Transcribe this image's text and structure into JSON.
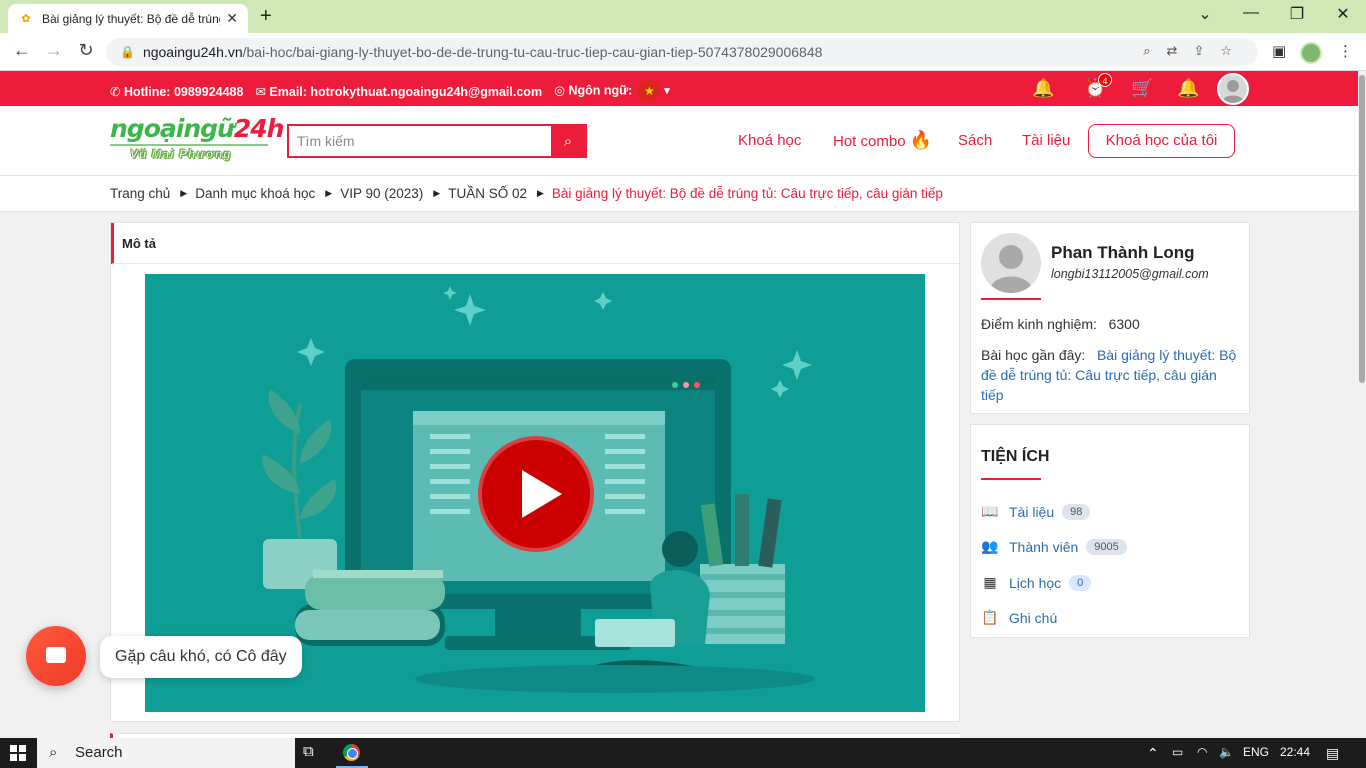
{
  "browser": {
    "tab_title": "Bài giảng lý thuyết: Bộ đề dễ trúng",
    "url_host": "ngoaingu24h.vn",
    "url_path": "/bai-hoc/bai-giang-ly-thuyet-bo-de-de-trung-tu-cau-truc-tiep-cau-gian-tiep-5074378029006848"
  },
  "topbar": {
    "hotline": "Hotline: 0989924488",
    "email": "Email: hotrokythuat.ngoaingu24h@gmail.com",
    "language_label": "Ngôn ngữ:",
    "alarm_badge": "4",
    "flag_color": "#da251d",
    "bar_color": "#ec1c3a"
  },
  "header": {
    "logo_text_green": "ngoại",
    "logo_text_green2": "ngữ",
    "logo_text_red": "24h",
    "logo_sub": "Vũ Mai Phương",
    "search_placeholder": "Tìm kiếm",
    "nav": {
      "courses": "Khoá học",
      "hot_combo": "Hot combo",
      "books": "Sách",
      "documents": "Tài liệu",
      "my_courses": "Khoá học của tôi"
    }
  },
  "breadcrumb": [
    "Trang chủ",
    "Danh mục khoá học",
    "VIP 90 (2023)",
    "TUẦN SỐ 02",
    "Bài giảng lý thuyết: Bộ đề dễ trúng tủ: Câu trực tiếp, câu gián tiếp"
  ],
  "main": {
    "section_title": "Mô tả"
  },
  "profile": {
    "name": "Phan Thành Long",
    "email": "longbi13112005@gmail.com",
    "exp_label": "Điểm kinh nghiệm:",
    "exp_value": "6300",
    "recent_label": "Bài học gần đây:",
    "recent_lesson": "Bài giảng lý thuyết: Bộ đề dễ trúng tủ: Câu trực tiếp, câu gián tiếp"
  },
  "tools": {
    "title": "TIỆN ÍCH",
    "items": [
      {
        "label": "Tài liệu",
        "count": "98",
        "icon": "book-icon"
      },
      {
        "label": "Thành viên",
        "count": "9005",
        "icon": "users-icon"
      },
      {
        "label": "Lịch học",
        "count": "0",
        "icon": "calendar-icon"
      },
      {
        "label": "Ghi chú",
        "icon": "clipboard-icon"
      }
    ]
  },
  "chat": {
    "tooltip": "Gặp câu khó, có Cô đây"
  },
  "taskbar": {
    "search_label": "Search",
    "language": "ENG",
    "time": "22:44"
  }
}
